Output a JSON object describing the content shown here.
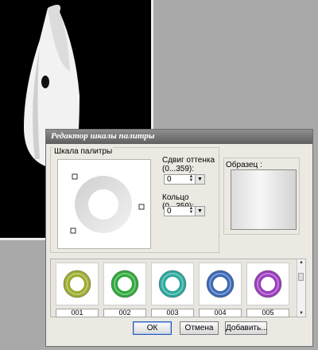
{
  "dialog": {
    "title": "Редактор шкалы палитры",
    "scale_group_label": "Шкала палитры",
    "hue_shift_label": "Сдвиг оттенка (0...359):",
    "hue_shift_value": "0",
    "ring_label": "Кольцо (0...359):",
    "ring_value": "0",
    "sample_label": "Образец :",
    "thumbnails": [
      {
        "label": "001",
        "color": "#9cab2c"
      },
      {
        "label": "002",
        "color": "#2ea83b"
      },
      {
        "label": "003",
        "color": "#2aa89c"
      },
      {
        "label": "004",
        "color": "#3a68b5"
      },
      {
        "label": "005",
        "color": "#9b3bbb"
      }
    ],
    "buttons": {
      "ok": "ОК",
      "cancel": "Отмена",
      "add": "Добавить..."
    }
  }
}
